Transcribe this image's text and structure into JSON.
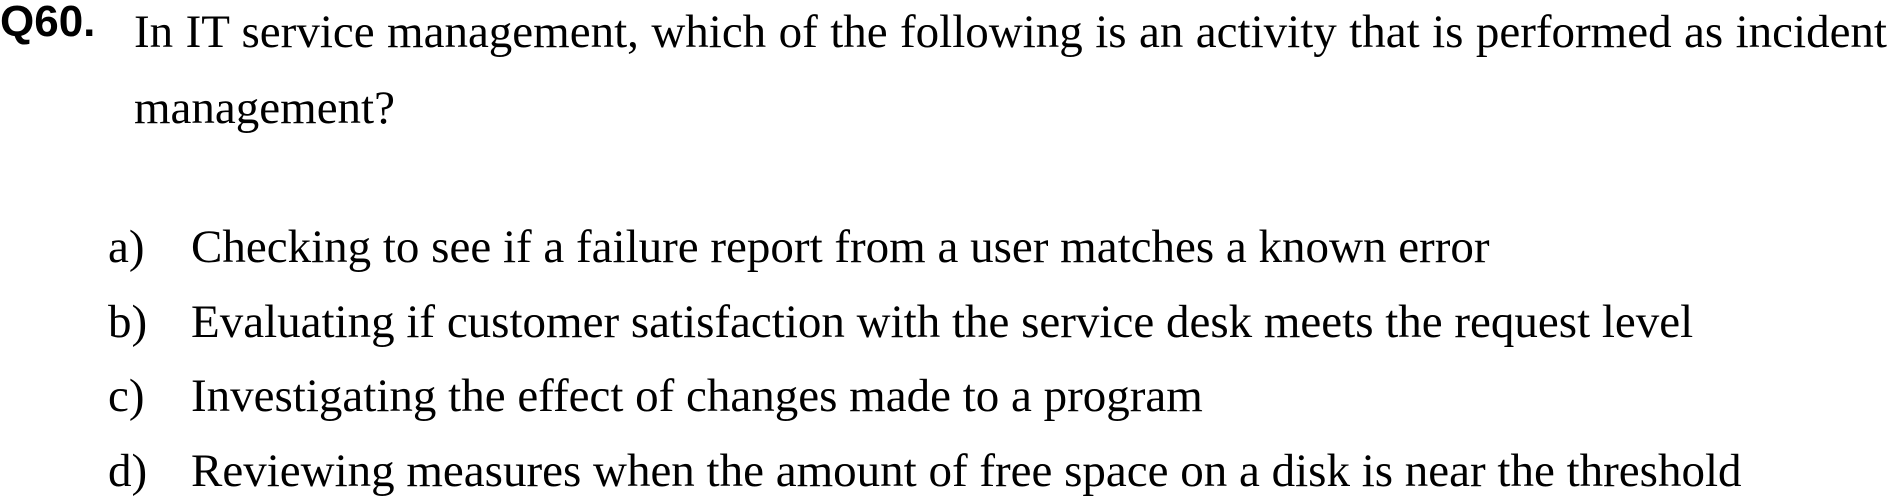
{
  "question": {
    "number": "Q60.",
    "text": "In IT service management, which of the following is an activity that is performed as incident management?"
  },
  "choices": [
    {
      "letter": "a)",
      "text": "Checking to see if a failure report from a user matches a known error"
    },
    {
      "letter": "b)",
      "text": "Evaluating if customer satisfaction with the service desk meets the request level"
    },
    {
      "letter": "c)",
      "text": "Investigating the effect of changes made to a program"
    },
    {
      "letter": "d)",
      "text": "Reviewing measures when the amount of free space on a disk is near the threshold"
    }
  ]
}
